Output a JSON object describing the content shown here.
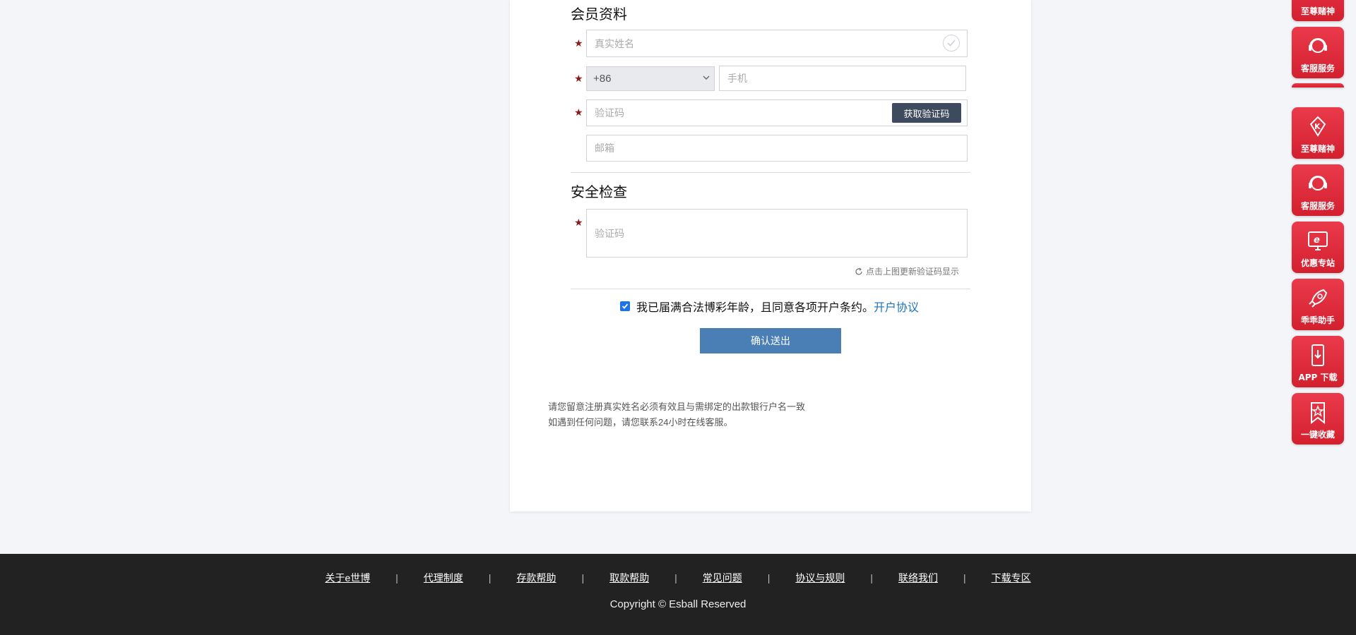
{
  "member_section": {
    "title": "会员资料",
    "real_name_placeholder": "真实姓名",
    "country_code": "+86",
    "phone_placeholder": "手机",
    "code_placeholder": "验证码",
    "get_code_label": "获取验证码",
    "email_placeholder": "邮箱"
  },
  "security_section": {
    "title": "安全检查",
    "captcha_placeholder": "验证码",
    "refresh_hint": "点击上图更新验证码显示"
  },
  "agreement": {
    "checked": true,
    "text": "我已届满合法博彩年龄，且同意各项开户条约。",
    "link_label": "开户协议"
  },
  "submit_label": "确认送出",
  "notes": [
    "请您留意注册真实姓名必须有效且与需绑定的出款银行户名一致",
    "如遇到任何问题，请您联系24小时在线客服。"
  ],
  "footer": {
    "links": [
      "关于e世博",
      "代理制度",
      "存款帮助",
      "取款帮助",
      "常见问题",
      "协议与规则",
      "联络我们",
      "下载专区"
    ],
    "copyright": "Copyright © Esball Reserved"
  },
  "sidebar": {
    "top_partial": [
      "至尊赌神",
      "客服服务"
    ],
    "items": [
      "至尊赌神",
      "客服服务",
      "优惠专站",
      "乖乖助手",
      "APP 下载",
      "一键收藏"
    ]
  },
  "colors": {
    "footer_bg": "#222223",
    "submit_bg": "#4a7fb5",
    "side_red": "#e02a3b",
    "link": "#1e73be",
    "star": "#8b1a1a"
  }
}
